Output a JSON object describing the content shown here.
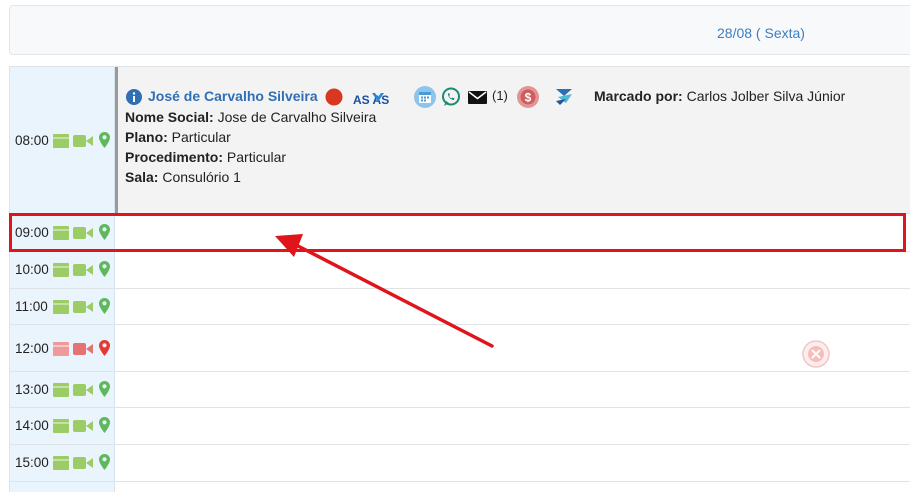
{
  "header": {
    "date": "28/08 ( Sexta)"
  },
  "slots": [
    {
      "time": "08:00",
      "status": "available"
    },
    {
      "time": "09:00",
      "status": "available"
    },
    {
      "time": "10:00",
      "status": "available"
    },
    {
      "time": "11:00",
      "status": "available"
    },
    {
      "time": "12:00",
      "status": "blocked"
    },
    {
      "time": "13:00",
      "status": "available"
    },
    {
      "time": "14:00",
      "status": "available"
    },
    {
      "time": "15:00",
      "status": "available"
    }
  ],
  "appointment": {
    "patient_name": "José de Carvalho Silveira",
    "asaas_logo_text": "ASAAS",
    "message_count": "(1)",
    "booked_by_label": "Marcado por:",
    "booked_by_value": "Carlos Jolber Silva Júnior",
    "social_name_label": "Nome Social:",
    "social_name_value": "Jose de Carvalho Silveira",
    "plan_label": "Plano:",
    "plan_value": "Particular",
    "procedure_label": "Procedimento:",
    "procedure_value": "Particular",
    "room_label": "Sala:",
    "room_value": "Consulório 1"
  },
  "colors": {
    "available_icon": "#9ccc65",
    "available_pin": "#5fb85c",
    "blocked_icon": "#ef9a9a",
    "blocked_pin": "#e53935",
    "highlight": "#e0151b",
    "link": "#2f6fb5"
  },
  "icons": [
    "info-icon",
    "status-dot-icon",
    "asaas-logo",
    "calendar-icon",
    "whatsapp-icon",
    "envelope-icon",
    "dollar-icon",
    "integration-icon",
    "card-icon",
    "video-icon",
    "location-pin-icon",
    "close-icon"
  ]
}
